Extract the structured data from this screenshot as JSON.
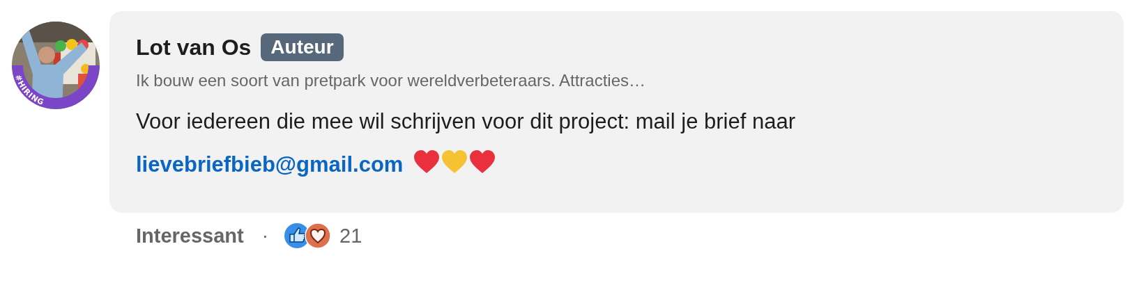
{
  "comment": {
    "author": "Lot van Os",
    "badge": "Auteur",
    "avatar": {
      "frame_label": "#HIRING"
    },
    "headline": "Ik bouw een soort van pretpark voor wereldverbeteraars. Attracties…",
    "body_text": "Voor iedereen die mee wil schrijven voor dit project: mail je brief naar",
    "link": "lievebriefbieb@gmail.com",
    "hearts": [
      {
        "color": "#e8303f"
      },
      {
        "color": "#f6c232"
      },
      {
        "color": "#e8303f"
      }
    ]
  },
  "footer": {
    "reaction_label": "Interessant",
    "separator": "·",
    "reactions": [
      {
        "kind": "like"
      },
      {
        "kind": "love"
      }
    ],
    "count": "21"
  }
}
